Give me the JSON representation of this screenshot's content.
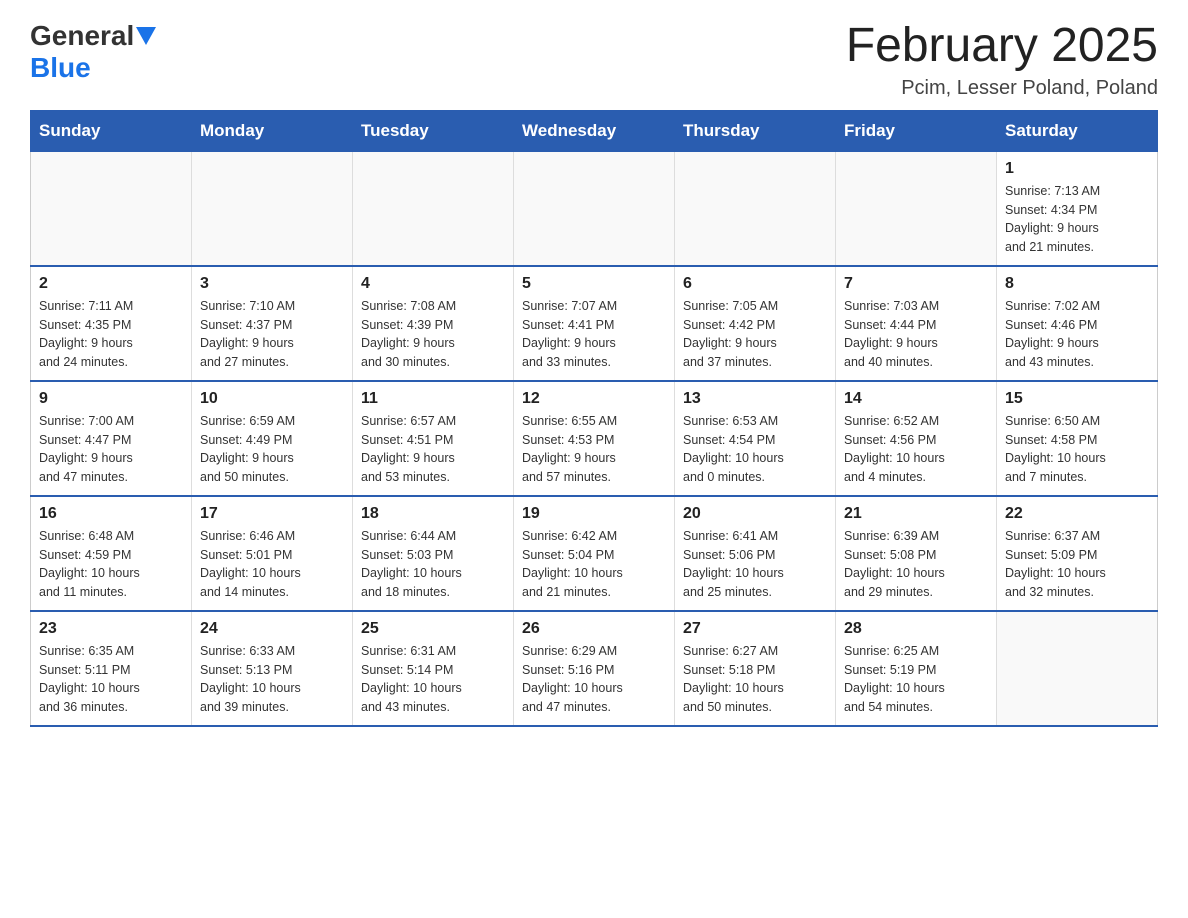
{
  "header": {
    "logo_general": "General",
    "logo_blue": "Blue",
    "title": "February 2025",
    "subtitle": "Pcim, Lesser Poland, Poland"
  },
  "days_of_week": [
    "Sunday",
    "Monday",
    "Tuesday",
    "Wednesday",
    "Thursday",
    "Friday",
    "Saturday"
  ],
  "weeks": [
    [
      {
        "day": "",
        "info": ""
      },
      {
        "day": "",
        "info": ""
      },
      {
        "day": "",
        "info": ""
      },
      {
        "day": "",
        "info": ""
      },
      {
        "day": "",
        "info": ""
      },
      {
        "day": "",
        "info": ""
      },
      {
        "day": "1",
        "info": "Sunrise: 7:13 AM\nSunset: 4:34 PM\nDaylight: 9 hours\nand 21 minutes."
      }
    ],
    [
      {
        "day": "2",
        "info": "Sunrise: 7:11 AM\nSunset: 4:35 PM\nDaylight: 9 hours\nand 24 minutes."
      },
      {
        "day": "3",
        "info": "Sunrise: 7:10 AM\nSunset: 4:37 PM\nDaylight: 9 hours\nand 27 minutes."
      },
      {
        "day": "4",
        "info": "Sunrise: 7:08 AM\nSunset: 4:39 PM\nDaylight: 9 hours\nand 30 minutes."
      },
      {
        "day": "5",
        "info": "Sunrise: 7:07 AM\nSunset: 4:41 PM\nDaylight: 9 hours\nand 33 minutes."
      },
      {
        "day": "6",
        "info": "Sunrise: 7:05 AM\nSunset: 4:42 PM\nDaylight: 9 hours\nand 37 minutes."
      },
      {
        "day": "7",
        "info": "Sunrise: 7:03 AM\nSunset: 4:44 PM\nDaylight: 9 hours\nand 40 minutes."
      },
      {
        "day": "8",
        "info": "Sunrise: 7:02 AM\nSunset: 4:46 PM\nDaylight: 9 hours\nand 43 minutes."
      }
    ],
    [
      {
        "day": "9",
        "info": "Sunrise: 7:00 AM\nSunset: 4:47 PM\nDaylight: 9 hours\nand 47 minutes."
      },
      {
        "day": "10",
        "info": "Sunrise: 6:59 AM\nSunset: 4:49 PM\nDaylight: 9 hours\nand 50 minutes."
      },
      {
        "day": "11",
        "info": "Sunrise: 6:57 AM\nSunset: 4:51 PM\nDaylight: 9 hours\nand 53 minutes."
      },
      {
        "day": "12",
        "info": "Sunrise: 6:55 AM\nSunset: 4:53 PM\nDaylight: 9 hours\nand 57 minutes."
      },
      {
        "day": "13",
        "info": "Sunrise: 6:53 AM\nSunset: 4:54 PM\nDaylight: 10 hours\nand 0 minutes."
      },
      {
        "day": "14",
        "info": "Sunrise: 6:52 AM\nSunset: 4:56 PM\nDaylight: 10 hours\nand 4 minutes."
      },
      {
        "day": "15",
        "info": "Sunrise: 6:50 AM\nSunset: 4:58 PM\nDaylight: 10 hours\nand 7 minutes."
      }
    ],
    [
      {
        "day": "16",
        "info": "Sunrise: 6:48 AM\nSunset: 4:59 PM\nDaylight: 10 hours\nand 11 minutes."
      },
      {
        "day": "17",
        "info": "Sunrise: 6:46 AM\nSunset: 5:01 PM\nDaylight: 10 hours\nand 14 minutes."
      },
      {
        "day": "18",
        "info": "Sunrise: 6:44 AM\nSunset: 5:03 PM\nDaylight: 10 hours\nand 18 minutes."
      },
      {
        "day": "19",
        "info": "Sunrise: 6:42 AM\nSunset: 5:04 PM\nDaylight: 10 hours\nand 21 minutes."
      },
      {
        "day": "20",
        "info": "Sunrise: 6:41 AM\nSunset: 5:06 PM\nDaylight: 10 hours\nand 25 minutes."
      },
      {
        "day": "21",
        "info": "Sunrise: 6:39 AM\nSunset: 5:08 PM\nDaylight: 10 hours\nand 29 minutes."
      },
      {
        "day": "22",
        "info": "Sunrise: 6:37 AM\nSunset: 5:09 PM\nDaylight: 10 hours\nand 32 minutes."
      }
    ],
    [
      {
        "day": "23",
        "info": "Sunrise: 6:35 AM\nSunset: 5:11 PM\nDaylight: 10 hours\nand 36 minutes."
      },
      {
        "day": "24",
        "info": "Sunrise: 6:33 AM\nSunset: 5:13 PM\nDaylight: 10 hours\nand 39 minutes."
      },
      {
        "day": "25",
        "info": "Sunrise: 6:31 AM\nSunset: 5:14 PM\nDaylight: 10 hours\nand 43 minutes."
      },
      {
        "day": "26",
        "info": "Sunrise: 6:29 AM\nSunset: 5:16 PM\nDaylight: 10 hours\nand 47 minutes."
      },
      {
        "day": "27",
        "info": "Sunrise: 6:27 AM\nSunset: 5:18 PM\nDaylight: 10 hours\nand 50 minutes."
      },
      {
        "day": "28",
        "info": "Sunrise: 6:25 AM\nSunset: 5:19 PM\nDaylight: 10 hours\nand 54 minutes."
      },
      {
        "day": "",
        "info": ""
      }
    ]
  ]
}
